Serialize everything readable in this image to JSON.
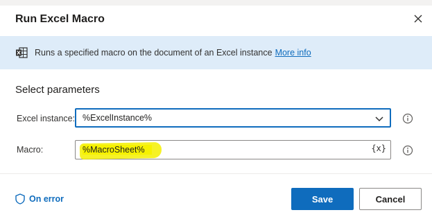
{
  "dialog": {
    "title": "Run Excel Macro",
    "close_icon": "close-icon"
  },
  "info": {
    "icon": "excel-icon",
    "text": "Runs a specified macro on the document of an Excel instance",
    "link": "More info"
  },
  "parameters": {
    "title": "Select parameters",
    "excel_instance": {
      "label": "Excel instance:",
      "value": "%ExcelInstance%",
      "icon": "chevron-down-icon"
    },
    "macro": {
      "label": "Macro:",
      "value": "%MacroSheet%",
      "variable_button": "{x}"
    }
  },
  "footer": {
    "on_error_label": "On error",
    "on_error_icon": "shield-icon",
    "save_label": "Save",
    "cancel_label": "Cancel"
  },
  "colors": {
    "accent": "#0f6cbd",
    "info_bar": "#deecf9",
    "highlight": "#f4f000"
  }
}
